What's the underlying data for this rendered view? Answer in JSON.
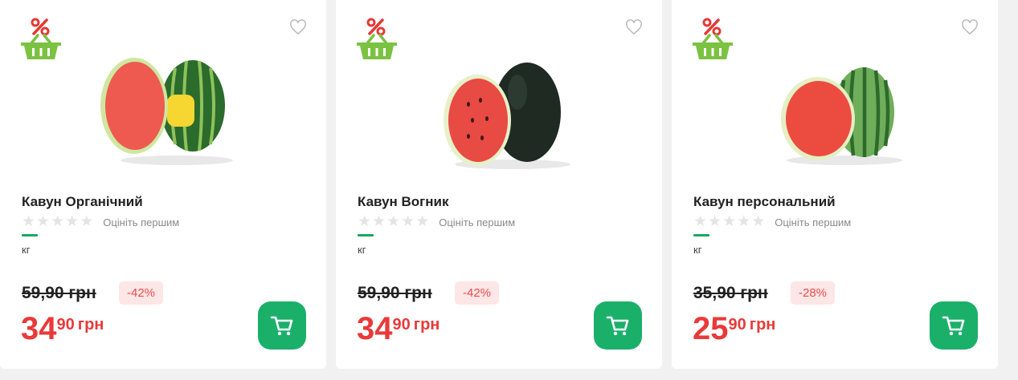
{
  "products": [
    {
      "name": "Кавун Органічний",
      "rating_cta": "Оцініть першим",
      "unit": "кг",
      "old_price": "59,90 грн",
      "discount": "-42%",
      "price_int": "34",
      "price_frac": "90",
      "currency": "грн",
      "rating_stars": 0
    },
    {
      "name": "Кавун Вогник",
      "rating_cta": "Оцініть першим",
      "unit": "кг",
      "old_price": "59,90 грн",
      "discount": "-42%",
      "price_int": "34",
      "price_frac": "90",
      "currency": "грн",
      "rating_stars": 0
    },
    {
      "name": "Кавун персональний",
      "rating_cta": "Оцініть першим",
      "unit": "кг",
      "old_price": "35,90 грн",
      "discount": "-28%",
      "price_int": "25",
      "price_frac": "90",
      "currency": "грн",
      "rating_stars": 0
    }
  ],
  "colors": {
    "accent_green": "#1ab06a",
    "price_red": "#e83a3a",
    "discount_bg": "#fde6e6",
    "promo_red": "#e53935",
    "promo_green": "#7cc242"
  },
  "icons": {
    "promo": "discount-basket-icon",
    "favorite": "heart-icon",
    "cart": "cart-icon"
  }
}
